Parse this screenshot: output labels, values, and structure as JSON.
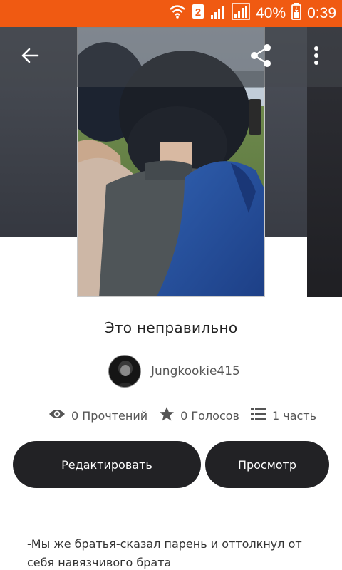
{
  "status_bar": {
    "sim_label": "2",
    "battery": "40%",
    "time": "0:39",
    "icons": [
      "wifi-icon",
      "sim-icon",
      "signal-icon",
      "signal-icon",
      "battery-charging-icon"
    ]
  },
  "colors": {
    "status_bar": "#f05a12",
    "button_bg": "#222225",
    "button_text": "#ffffff"
  },
  "toolbar": {
    "icons": [
      "back-arrow-icon",
      "share-icon",
      "more-vertical-icon"
    ]
  },
  "story": {
    "title": "Это неправильно",
    "author": "Jungkookie415",
    "reads": "0 Прочтений",
    "votes": "0 Голосов",
    "parts": "1 часть"
  },
  "actions": {
    "edit_label": "Редактировать",
    "view_label": "Просмотр"
  },
  "description": "-Мы же братья-сказал парень и оттолкнул от себя навязчивого брата"
}
